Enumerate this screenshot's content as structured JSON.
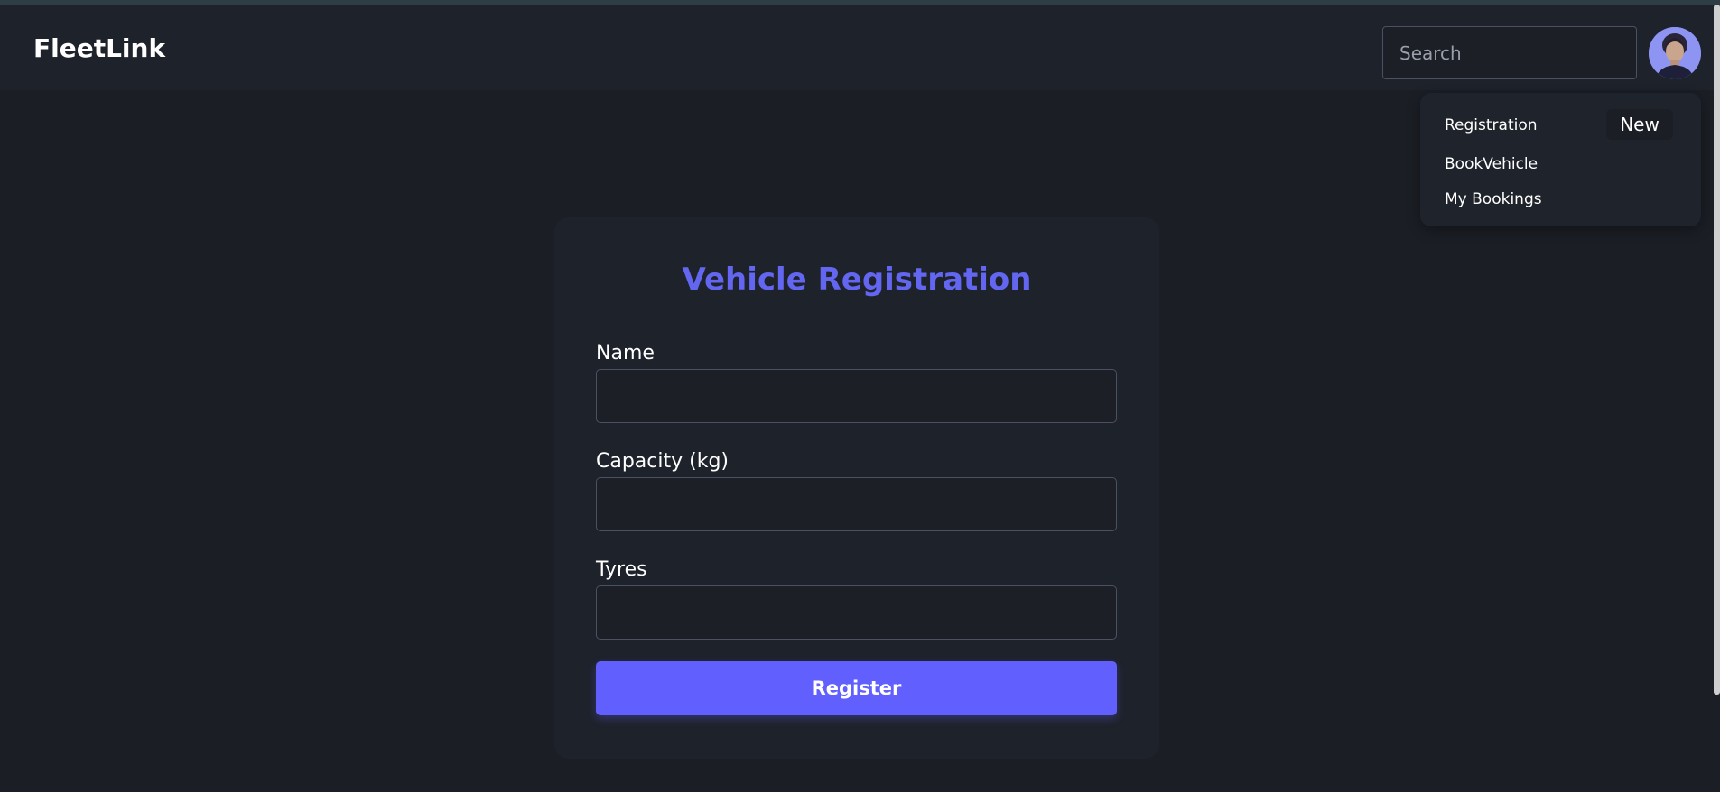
{
  "navbar": {
    "brand": "FleetLink",
    "search_placeholder": "Search",
    "avatar_icon": "user-avatar-photo"
  },
  "dropdown": {
    "items": [
      {
        "label": "Registration",
        "badge": "New"
      },
      {
        "label": "BookVehicle"
      },
      {
        "label": "My Bookings"
      }
    ]
  },
  "form": {
    "title": "Vehicle Registration",
    "fields": [
      {
        "label": "Name",
        "value": ""
      },
      {
        "label": "Capacity (kg)",
        "value": ""
      },
      {
        "label": "Tyres",
        "value": ""
      }
    ],
    "submit_label": "Register"
  },
  "colors": {
    "background": "#1b1e25",
    "surface": "#1e222a",
    "accent": "#6160ff",
    "title": "#6366f1",
    "border": "#4b5160"
  }
}
